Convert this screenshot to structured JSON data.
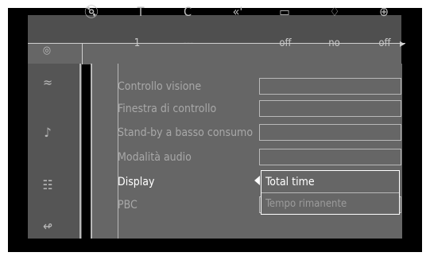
{
  "status_bar": {
    "icons": [
      "disc-icon",
      "title-icon",
      "chapter-icon",
      "audio-icon",
      "subtitle-icon",
      "angle-icon",
      "zoom-icon"
    ],
    "values": [
      "1",
      "---",
      "off",
      "no",
      "off"
    ]
  },
  "sidebar": {
    "icons": [
      "picture-settings-icon",
      "music-note-icon",
      "speech-bubble-icon",
      "plug-icon"
    ]
  },
  "menu": {
    "items": [
      {
        "label": "Controllo visione"
      },
      {
        "label": "Finestra di controllo"
      },
      {
        "label": "Stand-by a basso consumo"
      },
      {
        "label": "Modalità audio"
      },
      {
        "label": "Display"
      },
      {
        "label": "PBC"
      }
    ],
    "active_index": 4
  },
  "display_dropdown": {
    "options": [
      "Total time",
      "Tempo rimanente"
    ],
    "selected": "Total time"
  }
}
